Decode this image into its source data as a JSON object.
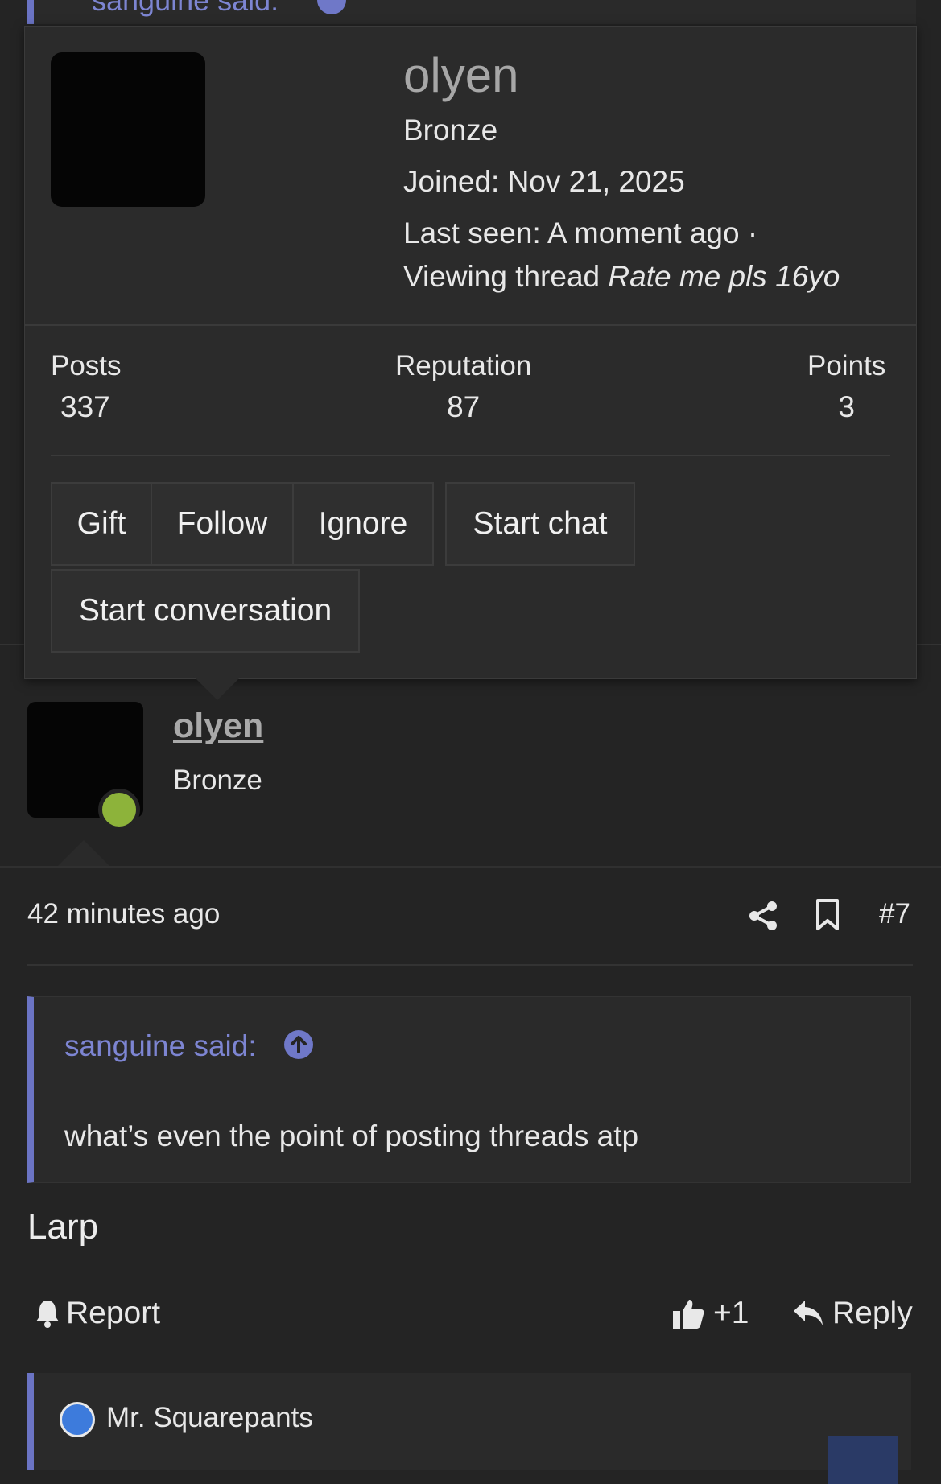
{
  "top_quote": {
    "said": "sanguine said:"
  },
  "popup": {
    "username": "olyen",
    "rank": "Bronze",
    "joined": "Joined: Nov 21, 2025",
    "last_seen": "Last seen: A moment ago ·",
    "viewing_prefix": "Viewing thread",
    "viewing_thread": "Rate me pls 16yo",
    "stats": [
      {
        "label": "Posts",
        "value": "337"
      },
      {
        "label": "Reputation",
        "value": "87"
      },
      {
        "label": "Points",
        "value": "3"
      }
    ],
    "buttons": {
      "gift": "Gift",
      "follow": "Follow",
      "ignore": "Ignore",
      "start_chat": "Start chat",
      "start_conversation": "Start conversation"
    }
  },
  "post": {
    "username": "olyen",
    "rank": "Bronze",
    "time": "42 minutes ago",
    "post_number": "#7",
    "quote": {
      "said": "sanguine said:",
      "text": "what’s even the point of posting threads atp"
    },
    "body": "Larp",
    "actions": {
      "report": "Report",
      "like": "+1",
      "reply": "Reply"
    },
    "likes": {
      "names": "Mr. Squarepants"
    }
  },
  "colors": {
    "background": "#242424",
    "quote_accent": "#6b74c4",
    "online": "#8db33a",
    "like_blue": "#3d7bdc"
  }
}
